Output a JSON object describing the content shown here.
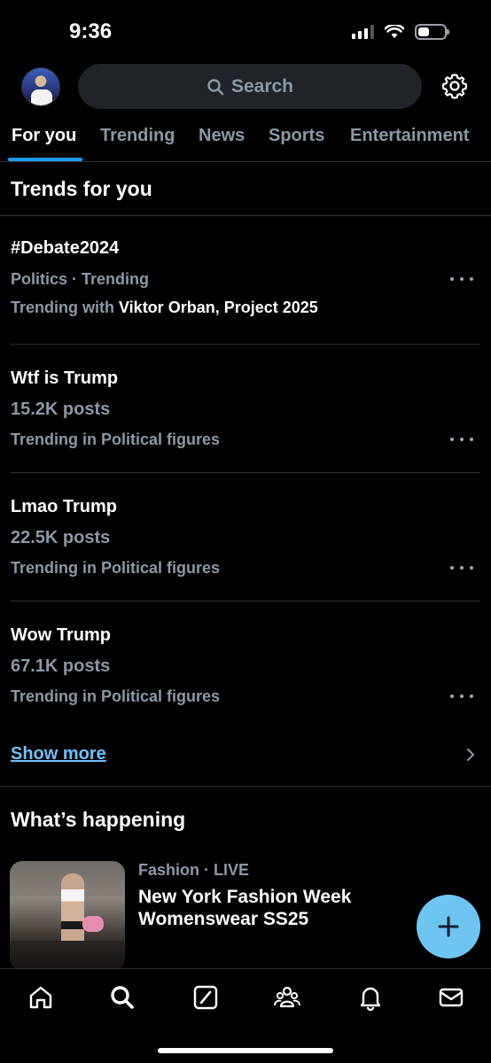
{
  "status_bar": {
    "time": "9:36"
  },
  "header": {
    "search_placeholder": "Search"
  },
  "tabs": [
    {
      "label": "For you",
      "active": true
    },
    {
      "label": "Trending",
      "active": false
    },
    {
      "label": "News",
      "active": false
    },
    {
      "label": "Sports",
      "active": false
    },
    {
      "label": "Entertainment",
      "active": false
    }
  ],
  "trends_section": {
    "title": "Trends for you",
    "items": [
      {
        "title": "#Debate2024",
        "category": "Politics · Trending",
        "context_prefix": "Trending with ",
        "context_names": "Viktor Orban, Project 2025"
      },
      {
        "title": "Wtf is Trump",
        "posts": "15.2K posts",
        "context": "Trending in Political figures"
      },
      {
        "title": "Lmao Trump",
        "posts": "22.5K posts",
        "context": "Trending in Political figures"
      },
      {
        "title": "Wow Trump",
        "posts": "67.1K posts",
        "context": "Trending in Political figures"
      }
    ],
    "show_more": "Show more"
  },
  "happening_section": {
    "title": "What’s happening",
    "item": {
      "meta": "Fashion · LIVE",
      "title": "New York Fashion Week Womenswear SS25"
    }
  },
  "colors": {
    "accent": "#1d9bf0",
    "fab": "#6ec5f2",
    "link": "#6ec1ff",
    "muted_text": "#8b98a5"
  },
  "icons": {
    "nav": [
      "home-icon",
      "search-icon",
      "grok-icon",
      "communities-icon",
      "notifications-icon",
      "messages-icon"
    ],
    "header": [
      "avatar",
      "settings-gear-icon"
    ],
    "fab": "plus-icon"
  }
}
